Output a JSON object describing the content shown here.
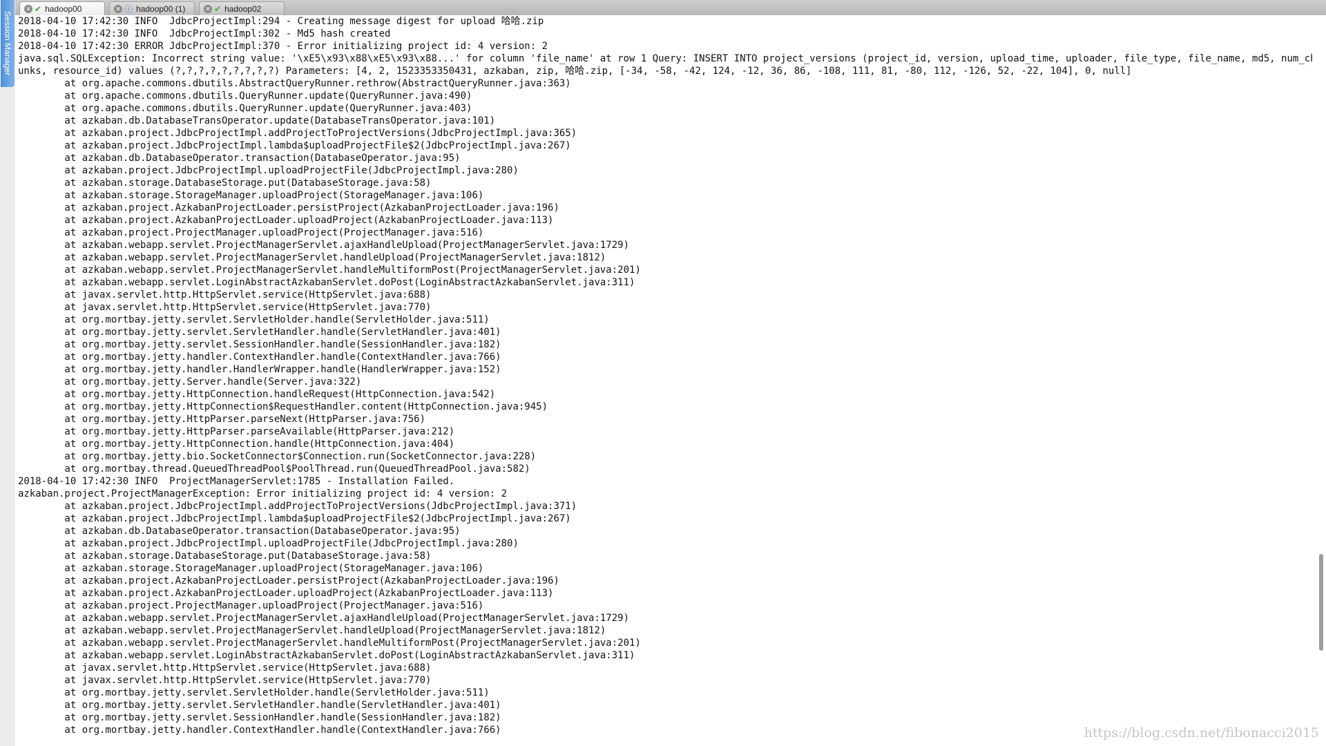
{
  "session_manager": {
    "label": "Session Manager"
  },
  "tabs": [
    {
      "label": "hadoop00",
      "active": true,
      "status_icon": "check-icon"
    },
    {
      "label": "hadoop00 (1)",
      "active": false,
      "status_icon": "info-icon"
    },
    {
      "label": "hadoop02",
      "active": false,
      "status_icon": "check-icon"
    }
  ],
  "terminal": {
    "lines": [
      "2018-04-10 17:42:30 INFO  JdbcProjectImpl:294 - Creating message digest for upload 哈哈.zip",
      "2018-04-10 17:42:30 INFO  JdbcProjectImpl:302 - Md5 hash created",
      "2018-04-10 17:42:30 ERROR JdbcProjectImpl:370 - Error initializing project id: 4 version: 2",
      "java.sql.SQLException: Incorrect string value: '\\xE5\\x93\\x88\\xE5\\x93\\x88...' for column 'file_name' at row 1 Query: INSERT INTO project_versions (project_id, version, upload_time, uploader, file_type, file_name, md5, num_ch",
      "unks, resource_id) values (?,?,?,?,?,?,?,?,?) Parameters: [4, 2, 1523353350431, azkaban, zip, 哈哈.zip, [-34, -58, -42, 124, -12, 36, 86, -108, 111, 81, -80, 112, -126, 52, -22, 104], 0, null]",
      "        at org.apache.commons.dbutils.AbstractQueryRunner.rethrow(AbstractQueryRunner.java:363)",
      "        at org.apache.commons.dbutils.QueryRunner.update(QueryRunner.java:490)",
      "        at org.apache.commons.dbutils.QueryRunner.update(QueryRunner.java:403)",
      "        at azkaban.db.DatabaseTransOperator.update(DatabaseTransOperator.java:101)",
      "        at azkaban.project.JdbcProjectImpl.addProjectToProjectVersions(JdbcProjectImpl.java:365)",
      "        at azkaban.project.JdbcProjectImpl.lambda$uploadProjectFile$2(JdbcProjectImpl.java:267)",
      "        at azkaban.db.DatabaseOperator.transaction(DatabaseOperator.java:95)",
      "        at azkaban.project.JdbcProjectImpl.uploadProjectFile(JdbcProjectImpl.java:280)",
      "        at azkaban.storage.DatabaseStorage.put(DatabaseStorage.java:58)",
      "        at azkaban.storage.StorageManager.uploadProject(StorageManager.java:106)",
      "        at azkaban.project.AzkabanProjectLoader.persistProject(AzkabanProjectLoader.java:196)",
      "        at azkaban.project.AzkabanProjectLoader.uploadProject(AzkabanProjectLoader.java:113)",
      "        at azkaban.project.ProjectManager.uploadProject(ProjectManager.java:516)",
      "        at azkaban.webapp.servlet.ProjectManagerServlet.ajaxHandleUpload(ProjectManagerServlet.java:1729)",
      "        at azkaban.webapp.servlet.ProjectManagerServlet.handleUpload(ProjectManagerServlet.java:1812)",
      "        at azkaban.webapp.servlet.ProjectManagerServlet.handleMultiformPost(ProjectManagerServlet.java:201)",
      "        at azkaban.webapp.servlet.LoginAbstractAzkabanServlet.doPost(LoginAbstractAzkabanServlet.java:311)",
      "        at javax.servlet.http.HttpServlet.service(HttpServlet.java:688)",
      "        at javax.servlet.http.HttpServlet.service(HttpServlet.java:770)",
      "        at org.mortbay.jetty.servlet.ServletHolder.handle(ServletHolder.java:511)",
      "        at org.mortbay.jetty.servlet.ServletHandler.handle(ServletHandler.java:401)",
      "        at org.mortbay.jetty.servlet.SessionHandler.handle(SessionHandler.java:182)",
      "        at org.mortbay.jetty.handler.ContextHandler.handle(ContextHandler.java:766)",
      "        at org.mortbay.jetty.handler.HandlerWrapper.handle(HandlerWrapper.java:152)",
      "        at org.mortbay.jetty.Server.handle(Server.java:322)",
      "        at org.mortbay.jetty.HttpConnection.handleRequest(HttpConnection.java:542)",
      "        at org.mortbay.jetty.HttpConnection$RequestHandler.content(HttpConnection.java:945)",
      "        at org.mortbay.jetty.HttpParser.parseNext(HttpParser.java:756)",
      "        at org.mortbay.jetty.HttpParser.parseAvailable(HttpParser.java:212)",
      "        at org.mortbay.jetty.HttpConnection.handle(HttpConnection.java:404)",
      "        at org.mortbay.jetty.bio.SocketConnector$Connection.run(SocketConnector.java:228)",
      "        at org.mortbay.thread.QueuedThreadPool$PoolThread.run(QueuedThreadPool.java:582)",
      "2018-04-10 17:42:30 INFO  ProjectManagerServlet:1785 - Installation Failed.",
      "azkaban.project.ProjectManagerException: Error initializing project id: 4 version: 2",
      "        at azkaban.project.JdbcProjectImpl.addProjectToProjectVersions(JdbcProjectImpl.java:371)",
      "        at azkaban.project.JdbcProjectImpl.lambda$uploadProjectFile$2(JdbcProjectImpl.java:267)",
      "        at azkaban.db.DatabaseOperator.transaction(DatabaseOperator.java:95)",
      "        at azkaban.project.JdbcProjectImpl.uploadProjectFile(JdbcProjectImpl.java:280)",
      "        at azkaban.storage.DatabaseStorage.put(DatabaseStorage.java:58)",
      "        at azkaban.storage.StorageManager.uploadProject(StorageManager.java:106)",
      "        at azkaban.project.AzkabanProjectLoader.persistProject(AzkabanProjectLoader.java:196)",
      "        at azkaban.project.AzkabanProjectLoader.uploadProject(AzkabanProjectLoader.java:113)",
      "        at azkaban.project.ProjectManager.uploadProject(ProjectManager.java:516)",
      "        at azkaban.webapp.servlet.ProjectManagerServlet.ajaxHandleUpload(ProjectManagerServlet.java:1729)",
      "        at azkaban.webapp.servlet.ProjectManagerServlet.handleUpload(ProjectManagerServlet.java:1812)",
      "        at azkaban.webapp.servlet.ProjectManagerServlet.handleMultiformPost(ProjectManagerServlet.java:201)",
      "        at azkaban.webapp.servlet.LoginAbstractAzkabanServlet.doPost(LoginAbstractAzkabanServlet.java:311)",
      "        at javax.servlet.http.HttpServlet.service(HttpServlet.java:688)",
      "        at javax.servlet.http.HttpServlet.service(HttpServlet.java:770)",
      "        at org.mortbay.jetty.servlet.ServletHolder.handle(ServletHolder.java:511)",
      "        at org.mortbay.jetty.servlet.ServletHandler.handle(ServletHandler.java:401)",
      "        at org.mortbay.jetty.servlet.SessionHandler.handle(SessionHandler.java:182)",
      "        at org.mortbay.jetty.handler.ContextHandler.handle(ContextHandler.java:766)"
    ]
  },
  "scrollbar": {
    "position": 0.85
  },
  "watermark": "https://blog.csdn.net/fibonacci2015"
}
